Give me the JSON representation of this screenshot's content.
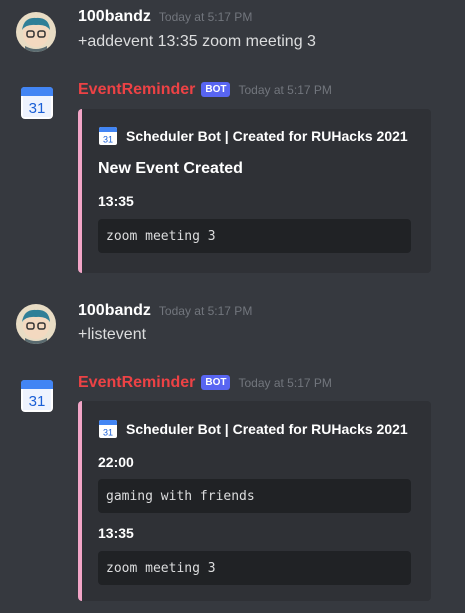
{
  "messages": [
    {
      "username": "100bandz",
      "timestamp": "Today at 5:17 PM",
      "content": "+addevent 13:35 zoom meeting 3",
      "avatar": "anime-avatar-icon"
    },
    {
      "username": "EventReminder",
      "bot_tag": "BOT",
      "timestamp": "Today at 5:17 PM",
      "avatar": "google-calendar-icon",
      "avatar_number": "31",
      "embed": {
        "author_icon_number": "31",
        "author": "Scheduler Bot | Created for RUHacks 2021",
        "title": "New Event Created",
        "fields": [
          {
            "name": "13:35",
            "value": "zoom meeting 3"
          }
        ]
      }
    },
    {
      "username": "100bandz",
      "timestamp": "Today at 5:17 PM",
      "content": "+listevent",
      "avatar": "anime-avatar-icon"
    },
    {
      "username": "EventReminder",
      "bot_tag": "BOT",
      "timestamp": "Today at 5:17 PM",
      "avatar": "google-calendar-icon",
      "avatar_number": "31",
      "embed": {
        "author_icon_number": "31",
        "author": "Scheduler Bot | Created for RUHacks 2021",
        "fields": [
          {
            "name": "22:00",
            "value": "gaming with friends"
          },
          {
            "name": "13:35",
            "value": "zoom meeting 3"
          }
        ]
      }
    }
  ],
  "colors": {
    "background": "#36393f",
    "embed_background": "#2f3136",
    "embed_accent": "#f2a5c7",
    "bot_username": "#ed4245",
    "bot_tag": "#5865f2",
    "code_background": "#202225"
  }
}
